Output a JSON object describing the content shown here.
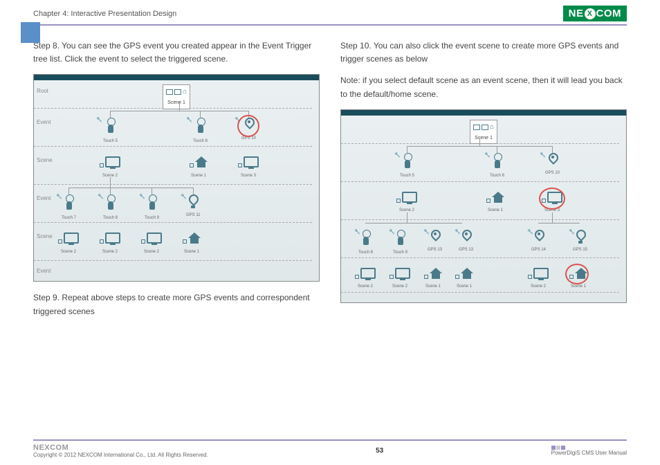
{
  "header": {
    "chapter": "Chapter 4: Interactive Presentation Design",
    "logo_text_1": "NE",
    "logo_x": "X",
    "logo_text_2": "COM"
  },
  "left": {
    "step8": "Step 8. You can see the GPS event you created appear in the Event Trigger tree list. Click the event to select the triggered scene.",
    "step9": "Step 9. Repeat above steps to create more GPS events and correspondent triggered scenes",
    "ss1": {
      "root_label": "Scene 1",
      "rows": {
        "root": "Root",
        "event1": "Event",
        "scene1": "Scene",
        "event2": "Event",
        "scene2": "Scene",
        "event3": "Event"
      },
      "ev1": {
        "touch5": "Touch 5",
        "touch6": "Touch 6",
        "gps10": "GPS 10"
      },
      "sc1": {
        "scene2": "Scene 2",
        "scene1": "Scene 1",
        "scene3": "Scene 3"
      },
      "ev2": {
        "touch7": "Touch 7",
        "touch8": "Touch 8",
        "touch9": "Touch 9",
        "gps11": "GPS 11"
      },
      "sc2": {
        "s2a": "Scene 2",
        "s2b": "Scene 2",
        "s2c": "Scene 2",
        "s1": "Scene 1"
      }
    }
  },
  "right": {
    "step10": "Step 10. You can also click the event scene to create more GPS events and trigger scenes as below",
    "note": "Note: if you select default scene as an event scene, then it will lead you back to the default/home scene.",
    "ss2": {
      "root_label": "Scene 1",
      "ev1": {
        "touch5": "Touch 5",
        "touch6": "Touch 6",
        "gps10": "GPS 10"
      },
      "sc1": {
        "scene2": "Scene 2",
        "scene1": "Scene 1",
        "scene3": "Scene 3"
      },
      "ev2": {
        "touch8": "Touch 8",
        "touch9": "Touch 9",
        "gps13": "GPS 13",
        "gps13b": "GPS 13",
        "gps14": "GPS 14",
        "gps15": "GPS 15"
      },
      "sc2": {
        "a": "Scene 2",
        "b": "Scene 2",
        "c": "Scene 1",
        "d": "Scene 1",
        "e": "Scene 2",
        "f": "Scene 1"
      }
    }
  },
  "footer": {
    "logo": "NEXCOM",
    "copyright": "Copyright © 2012 NEXCOM International Co., Ltd. All Rights Reserved.",
    "page": "53",
    "manual": "PowerDigiS CMS User Manual"
  }
}
